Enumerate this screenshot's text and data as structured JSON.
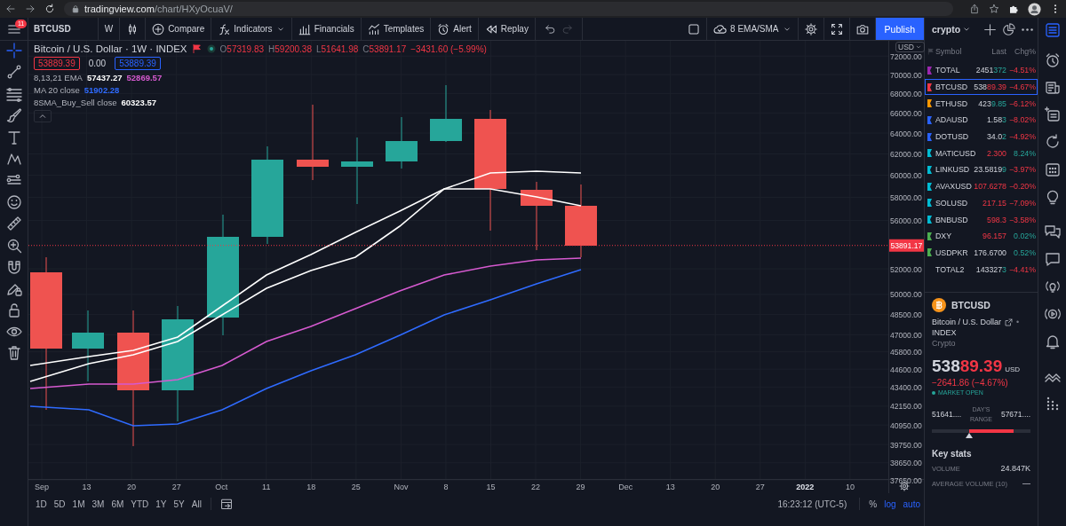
{
  "browser": {
    "url_domain": "tradingview.com",
    "url_path": "/chart/HXyOcuaV/"
  },
  "toolbar": {
    "menu_badge": "11",
    "symbol": "BTCUSD",
    "interval": "W",
    "buttons": [
      {
        "kind": "compare",
        "label": "Compare"
      },
      {
        "kind": "indicators",
        "label": "Indicators"
      },
      {
        "kind": "financials",
        "label": "Financials"
      },
      {
        "kind": "templates",
        "label": "Templates"
      },
      {
        "kind": "alert",
        "label": "Alert"
      },
      {
        "kind": "replay",
        "label": "Replay"
      }
    ],
    "history": [
      {
        "kind": "undo",
        "disabled": false
      },
      {
        "kind": "redo",
        "disabled": true
      }
    ],
    "layout": "8 EMA/SMA",
    "publish": "Publish"
  },
  "drawing_tools": [
    {
      "kind": "crosshair",
      "selected": true
    },
    {
      "kind": "trend-line",
      "selected": false
    },
    {
      "kind": "lines",
      "selected": false
    },
    {
      "kind": "brush",
      "selected": false
    },
    {
      "kind": "text",
      "selected": false
    },
    {
      "kind": "pattern",
      "selected": false
    },
    {
      "kind": "forecast",
      "selected": false
    },
    {
      "kind": "emoji",
      "selected": false
    },
    {
      "kind": "ruler",
      "selected": false
    },
    {
      "kind": "zoom",
      "selected": false
    },
    {
      "kind": "magnet",
      "selected": false
    },
    {
      "kind": "lock-drawing",
      "selected": false
    },
    {
      "kind": "lock",
      "selected": false
    },
    {
      "kind": "eye",
      "selected": false
    },
    {
      "kind": "trash",
      "selected": false
    }
  ],
  "legend": {
    "title": "Bitcoin / U.S. Dollar · 1W · INDEX",
    "falling": true,
    "ohlc": [
      {
        "letter": "O",
        "value": "57319.83"
      },
      {
        "letter": "H",
        "value": "59200.38"
      },
      {
        "letter": "L",
        "value": "51641.98"
      },
      {
        "letter": "C",
        "value": "53891.17"
      }
    ],
    "change": "−3431.60 (−5.99%)",
    "price_boxes": [
      {
        "text": "53889.39",
        "color": "#f23645"
      },
      {
        "text": "0.00"
      },
      {
        "text": "53889.39",
        "color": "#2962ff"
      }
    ],
    "indicators": [
      {
        "name": "8,13,21 EMA",
        "values": [
          {
            "text": "57437.27",
            "color": "#ffffff"
          },
          {
            "text": "52869.57",
            "color": "#d65ad0"
          }
        ]
      },
      {
        "name": "MA 20 close",
        "values": [
          {
            "text": "51902.28",
            "color": "#2f6bff"
          }
        ]
      },
      {
        "name": "8SMA_Buy_Sell close",
        "values": [
          {
            "text": "60323.57",
            "color": "#ffffff"
          }
        ]
      }
    ]
  },
  "chart": {
    "currency": "USD",
    "price_ticks": [
      "72000.00",
      "70000.00",
      "68000.00",
      "66000.00",
      "64000.00",
      "62000.00",
      "60000.00",
      "58000.00",
      "56000.00",
      "52000.00",
      "50000.00",
      "48500.00",
      "47000.00",
      "45800.00",
      "44600.00",
      "43400.00",
      "42150.00",
      "40950.00",
      "39750.00",
      "38650.00",
      "37650.00"
    ],
    "last_price": "53891.17",
    "time_ticks": [
      {
        "label": "Sep",
        "bold": false
      },
      {
        "label": "13",
        "bold": false
      },
      {
        "label": "20",
        "bold": false
      },
      {
        "label": "27",
        "bold": false
      },
      {
        "label": "Oct",
        "bold": false
      },
      {
        "label": "11",
        "bold": false
      },
      {
        "label": "18",
        "bold": false
      },
      {
        "label": "25",
        "bold": false
      },
      {
        "label": "Nov",
        "bold": false
      },
      {
        "label": "8",
        "bold": false
      },
      {
        "label": "15",
        "bold": false
      },
      {
        "label": "22",
        "bold": false
      },
      {
        "label": "29",
        "bold": false
      },
      {
        "label": "Dec",
        "bold": false
      },
      {
        "label": "13",
        "bold": false
      },
      {
        "label": "20",
        "bold": false
      },
      {
        "label": "27",
        "bold": false
      },
      {
        "label": "2022",
        "bold": true
      },
      {
        "label": "10",
        "bold": false
      }
    ]
  },
  "bottom_bar": {
    "ranges": [
      "1D",
      "5D",
      "1M",
      "3M",
      "6M",
      "YTD",
      "1Y",
      "5Y",
      "All"
    ],
    "time": "16:23:12 (UTC-5)",
    "scale": [
      {
        "label": "%",
        "selected": false
      },
      {
        "label": "log",
        "selected": true
      },
      {
        "label": "auto",
        "selected": true
      }
    ]
  },
  "watchlist": {
    "name": "crypto",
    "columns": [
      "Symbol",
      "Last",
      "Chg%"
    ],
    "rows": [
      {
        "symbol": "TOTAL",
        "color": "#9c27b0",
        "last_head": "2451",
        "last_tail": "372",
        "tail_falling": false,
        "change": "−4.51%",
        "falling": true,
        "selected": false
      },
      {
        "symbol": "BTCUSD",
        "color": "#f23645",
        "last_head": "538",
        "last_tail": "89.39",
        "tail_falling": true,
        "change": "−4.67%",
        "falling": true,
        "selected": true
      },
      {
        "symbol": "ETHUSD",
        "color": "#ff9800",
        "last_head": "423",
        "last_tail": "9.85",
        "tail_falling": false,
        "change": "−6.12%",
        "falling": true,
        "selected": false
      },
      {
        "symbol": "ADAUSD",
        "color": "#2962ff",
        "last_head": "1.58",
        "last_tail": "3",
        "tail_falling": false,
        "change": "−8.02%",
        "falling": true,
        "selected": false
      },
      {
        "symbol": "DOTUSD",
        "color": "#2962ff",
        "last_head": "34.0",
        "last_tail": "2",
        "tail_falling": false,
        "change": "−4.92%",
        "falling": true,
        "selected": false
      },
      {
        "symbol": "MATICUSD",
        "color": "#00bcd4",
        "last_tail": "2.300",
        "tail_falling": true,
        "change": "8.24%",
        "falling": false,
        "selected": false
      },
      {
        "symbol": "LINKUSD",
        "color": "#00bcd4",
        "last_head": "23.5819",
        "last_tail": "9",
        "tail_falling": false,
        "change": "−3.97%",
        "falling": true,
        "selected": false
      },
      {
        "symbol": "AVAXUSD",
        "color": "#00bcd4",
        "last_tail": "107.6278",
        "tail_falling": true,
        "change": "−0.20%",
        "falling": true,
        "selected": false
      },
      {
        "symbol": "SOLUSD",
        "color": "#00bcd4",
        "last_tail": "217.15",
        "tail_falling": true,
        "change": "−7.09%",
        "falling": true,
        "selected": false
      },
      {
        "symbol": "BNBUSD",
        "color": "#00bcd4",
        "last_tail": "598.3",
        "tail_falling": true,
        "change": "−3.58%",
        "falling": true,
        "selected": false
      },
      {
        "symbol": "DXY",
        "color": "#4caf50",
        "last_tail": "96.157",
        "tail_falling": true,
        "change": "0.02%",
        "falling": false,
        "selected": false
      },
      {
        "symbol": "USDPKR",
        "color": "#4caf50",
        "last_head": "176.6700",
        "change": "0.52%",
        "falling": false,
        "selected": false
      },
      {
        "symbol": "TOTAL2",
        "last_head": "143327",
        "last_tail": "3",
        "tail_falling": false,
        "change": "−4.41%",
        "falling": true,
        "selected": false
      }
    ]
  },
  "details": {
    "symbol": "BTCUSD",
    "name": "Bitcoin / U.S. Dollar",
    "name_suffix": "•",
    "exchange": "INDEX",
    "type": "Crypto",
    "price_head": "538",
    "price_tail": "89.39",
    "currency": "USD",
    "change": "−2641.86 (−4.67%)",
    "falling": true,
    "status": "MARKET OPEN",
    "range": {
      "low": "51641....",
      "label": "DAY'S RANGE",
      "high": "57671...."
    },
    "key_stats_title": "Key stats",
    "stats": [
      {
        "label": "VOLUME",
        "value": "24.847K"
      },
      {
        "label": "AVERAGE VOLUME (10)",
        "value": "—"
      }
    ]
  },
  "right_rail": [
    {
      "kind": "watchlist",
      "selected": true
    },
    {
      "kind": "alarm",
      "selected": false
    },
    {
      "kind": "news",
      "selected": false
    },
    {
      "kind": "list-add",
      "selected": false
    },
    {
      "kind": "refresh",
      "selected": false
    },
    {
      "kind": "calendar",
      "selected": false
    },
    {
      "kind": "ideas",
      "selected": false
    },
    {
      "kind": "chat",
      "selected": false
    },
    {
      "kind": "message",
      "selected": false
    },
    {
      "kind": "broadcast-bulb",
      "selected": false
    },
    {
      "kind": "broadcast-play",
      "selected": false
    },
    {
      "kind": "bell",
      "selected": false
    },
    {
      "kind": "zigzag",
      "selected": false
    },
    {
      "kind": "dot-grid",
      "selected": false
    }
  ]
}
